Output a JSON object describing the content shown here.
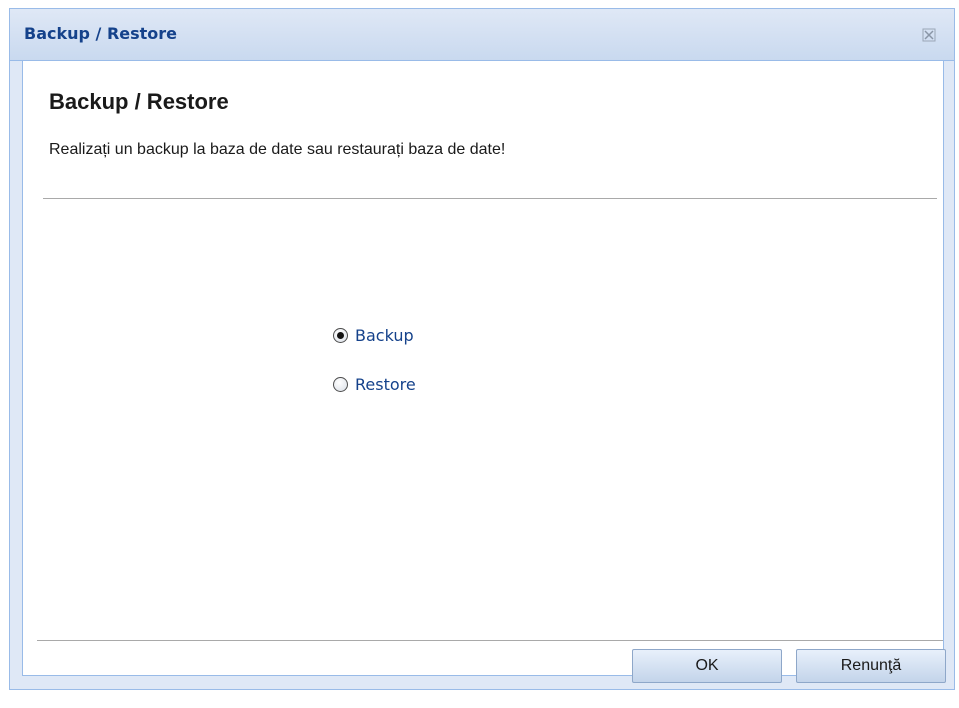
{
  "window": {
    "title": "Backup / Restore",
    "close_icon": "close-icon"
  },
  "header": {
    "title": "Backup / Restore",
    "subtitle": "Realizați un backup la baza de date sau restaurați baza de date!"
  },
  "options": {
    "selected": "Backup",
    "items": [
      {
        "label": "Backup",
        "checked": true
      },
      {
        "label": "Restore",
        "checked": false
      }
    ]
  },
  "buttons": {
    "ok_label": "OK",
    "cancel_label": "Renunţă"
  },
  "colors": {
    "accent": "#15428b",
    "border": "#99bbe8",
    "title_bar": "#dfe8f6"
  }
}
